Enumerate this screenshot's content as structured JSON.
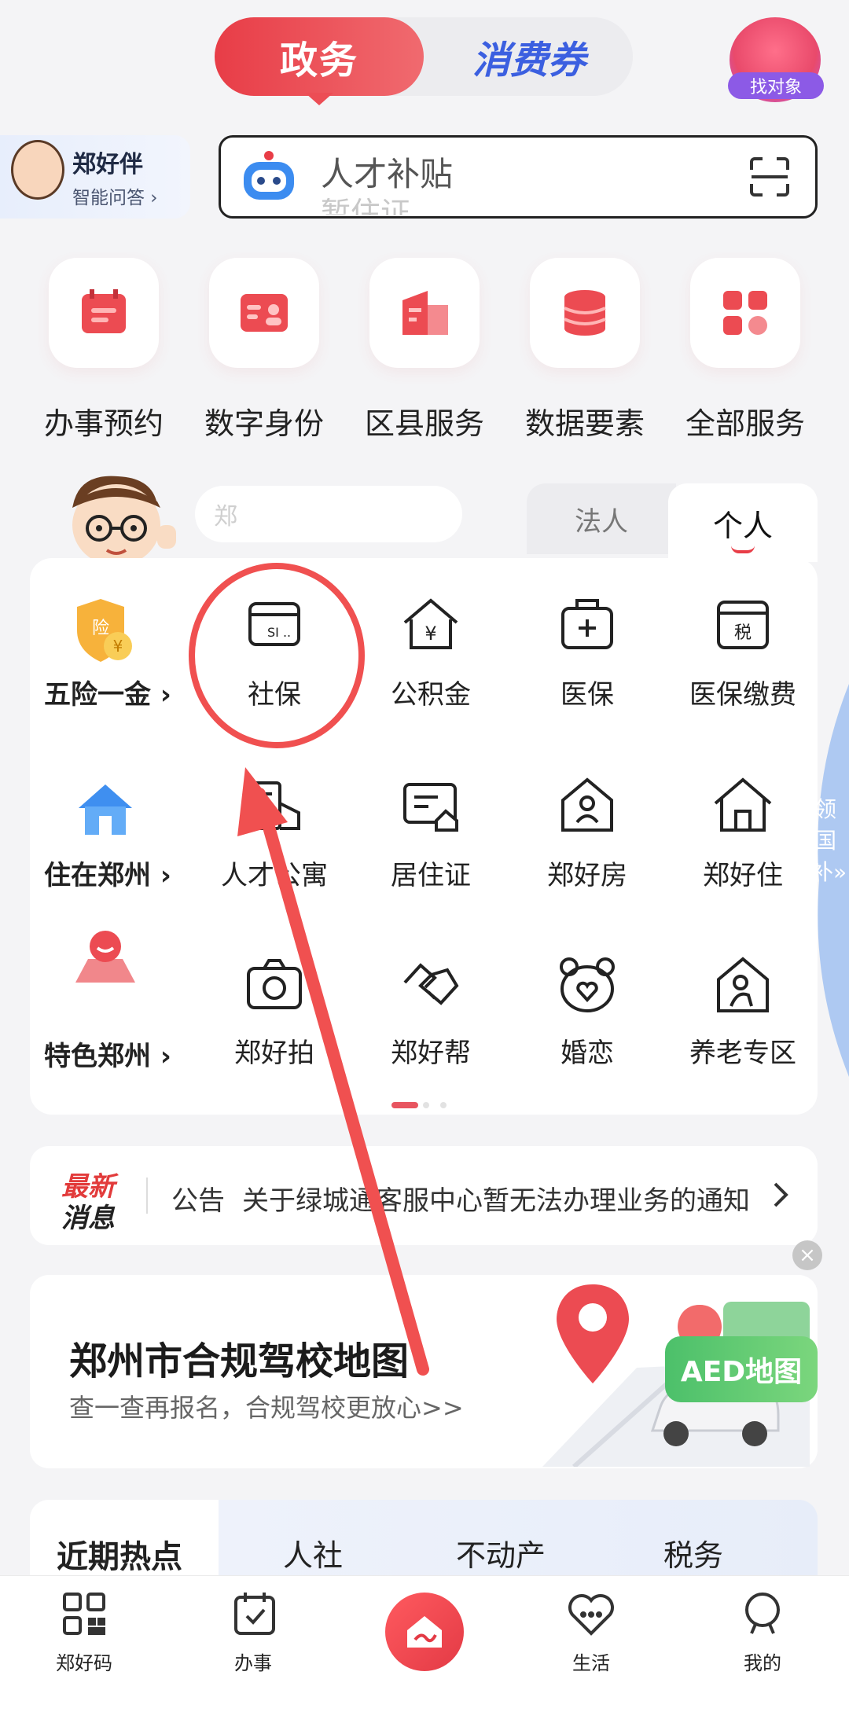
{
  "top_switch": {
    "active": "政务",
    "inactive": "消费券"
  },
  "top_right": {
    "label": "找对象"
  },
  "assistant": {
    "title": "郑好伴",
    "subtitle": "智能问答 ›"
  },
  "search": {
    "text": "人才补贴",
    "next_hint": "暂住证"
  },
  "quick_services": [
    {
      "label": "办事预约",
      "icon": "calendar-icon"
    },
    {
      "label": "数字身份",
      "icon": "id-card-icon"
    },
    {
      "label": "区县服务",
      "icon": "building-icon"
    },
    {
      "label": "数据要素",
      "icon": "database-icon"
    },
    {
      "label": "全部服务",
      "icon": "grid-icon"
    }
  ],
  "tabs": {
    "search_placeholder": "郑",
    "faren": "法人",
    "geren": "个人"
  },
  "categories": [
    {
      "label": "五险一金 ›",
      "items": [
        {
          "label": "社保",
          "icon": "si-card-icon"
        },
        {
          "label": "公积金",
          "icon": "house-yen-icon"
        },
        {
          "label": "医保",
          "icon": "medkit-icon"
        },
        {
          "label": "医保缴费",
          "icon": "tax-icon"
        }
      ]
    },
    {
      "label": "住在郑州 ›",
      "items": [
        {
          "label": "人才公寓",
          "icon": "apartment-icon"
        },
        {
          "label": "居住证",
          "icon": "residence-card-icon"
        },
        {
          "label": "郑好房",
          "icon": "house-person-icon"
        },
        {
          "label": "郑好住",
          "icon": "home-icon"
        }
      ]
    },
    {
      "label": "特色郑州 ›",
      "items": [
        {
          "label": "郑好拍",
          "icon": "camera-icon"
        },
        {
          "label": "郑好帮",
          "icon": "handshake-icon"
        },
        {
          "label": "婚恋",
          "icon": "bear-heart-icon"
        },
        {
          "label": "养老专区",
          "icon": "elderly-icon"
        }
      ]
    }
  ],
  "side_tab": {
    "label": "领国补»"
  },
  "news": {
    "badge_top": "最新",
    "badge_bottom": "消息",
    "tag": "公告",
    "text": "关于绿城通客服中心暂无法办理业务的通知"
  },
  "banner": {
    "title": "郑州市合规驾校地图",
    "subtitle": "查一查再报名，合规驾校更放心>>",
    "aed": "AED地图"
  },
  "hot_tabs": [
    "近期热点",
    "人社",
    "不动产",
    "税务"
  ],
  "bottom_nav": [
    {
      "label": "郑好码",
      "icon": "qr-code-icon"
    },
    {
      "label": "办事",
      "icon": "calendar-check-icon"
    },
    {
      "label": "",
      "icon": "home-center-icon"
    },
    {
      "label": "生活",
      "icon": "heart-chat-icon"
    },
    {
      "label": "我的",
      "icon": "person-icon"
    }
  ],
  "colors": {
    "brand_red": "#e83d47",
    "accent_blue": "#3b5fe0",
    "annotation_red": "#f05050"
  }
}
